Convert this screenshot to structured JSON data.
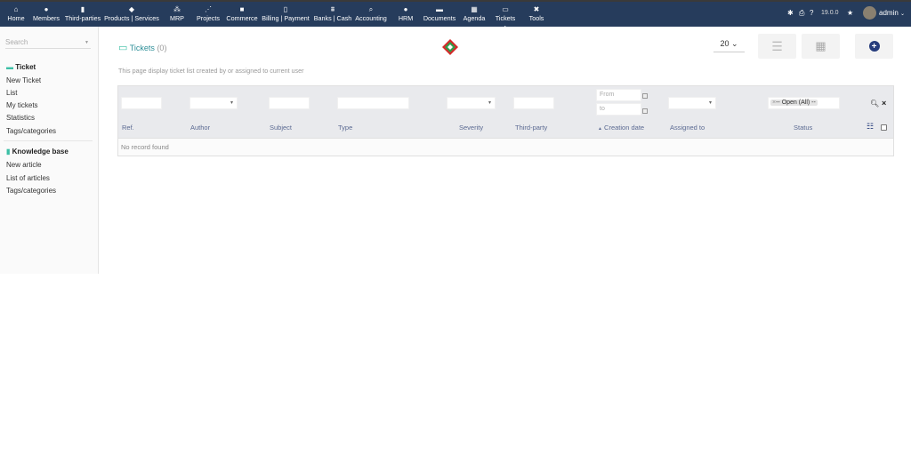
{
  "topnav": [
    {
      "label": "Home",
      "icon": "home-icon",
      "glyph": "⌂"
    },
    {
      "label": "Members",
      "icon": "user-icon",
      "glyph": "●"
    },
    {
      "label": "Third-parties",
      "icon": "building-icon",
      "glyph": "▮"
    },
    {
      "label": "Products | Services",
      "icon": "cube-icon",
      "glyph": "◆"
    },
    {
      "label": "MRP",
      "icon": "cubes-icon",
      "glyph": "⁂"
    },
    {
      "label": "Projects",
      "icon": "sitemap-icon",
      "glyph": "⋰"
    },
    {
      "label": "Commerce",
      "icon": "suitcase-icon",
      "glyph": "■"
    },
    {
      "label": "Billing | Payment",
      "icon": "file-invoice-icon",
      "glyph": "▯"
    },
    {
      "label": "Banks | Cash",
      "icon": "bank-icon",
      "glyph": "⩩"
    },
    {
      "label": "Accounting",
      "icon": "search-dollar-icon",
      "glyph": "⌕"
    },
    {
      "label": "HRM",
      "icon": "user-tie-icon",
      "glyph": "●"
    },
    {
      "label": "Documents",
      "icon": "folder-icon",
      "glyph": "▬"
    },
    {
      "label": "Agenda",
      "icon": "calendar-icon",
      "glyph": "▦"
    },
    {
      "label": "Tickets",
      "icon": "ticket-icon",
      "glyph": "▭"
    },
    {
      "label": "Tools",
      "icon": "tools-icon",
      "glyph": "✖"
    }
  ],
  "topright": {
    "version": "19.0.0",
    "user": "admin"
  },
  "sidebar": {
    "search_placeholder": "Search",
    "ticket_header": "Ticket",
    "ticket_items": [
      "New Ticket",
      "List",
      "My tickets",
      "Statistics",
      "Tags/categories"
    ],
    "kb_header": "Knowledge base",
    "kb_items": [
      "New article",
      "List of articles",
      "Tags/categories"
    ]
  },
  "page": {
    "title": "Tickets",
    "count": "(0)",
    "description": "This page display ticket list created by or assigned to current user",
    "page_size": "20"
  },
  "filters": {
    "from_placeholder": "From",
    "to_placeholder": "to",
    "status_value": "-- Open (All) --"
  },
  "columns": [
    "Ref.",
    "Author",
    "Subject",
    "Type",
    "Severity",
    "Third-party",
    "Creation date",
    "Assigned to",
    "Status"
  ],
  "sort_indicator": "▲",
  "empty_message": "No record found"
}
